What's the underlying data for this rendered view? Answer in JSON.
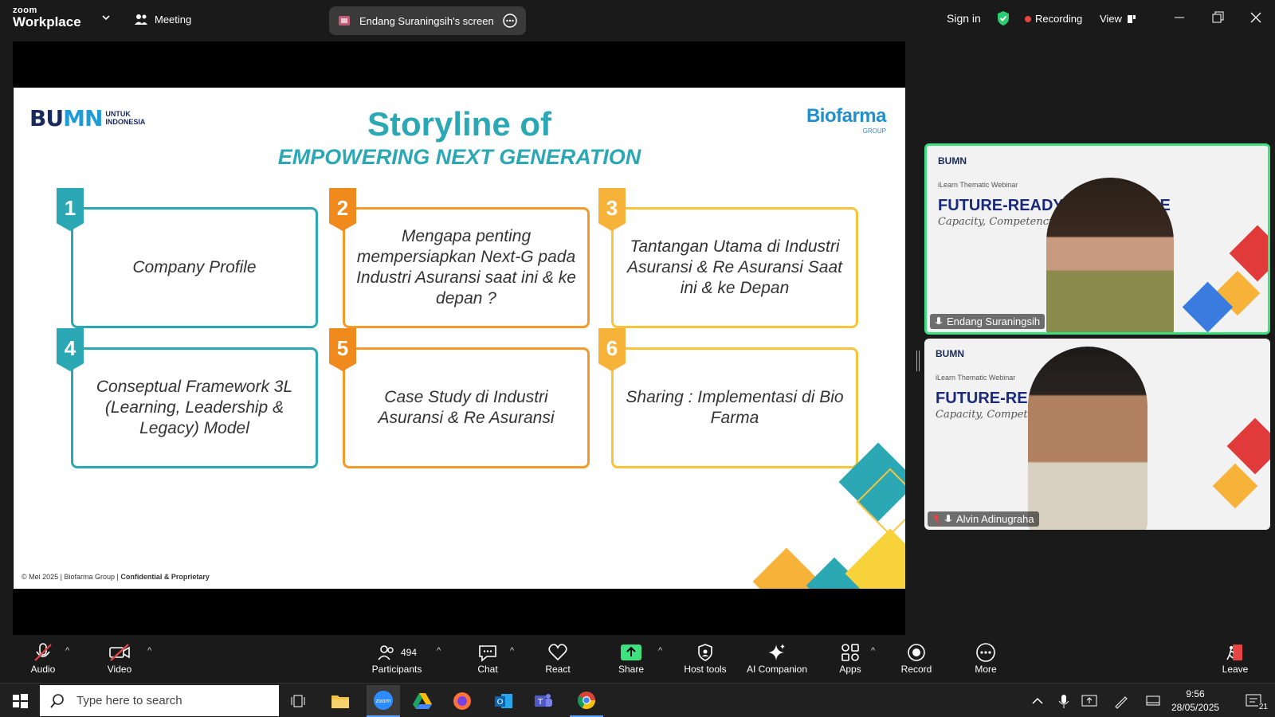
{
  "app": {
    "brand_small": "zoom",
    "brand_big": "Workplace",
    "meeting_label": "Meeting",
    "share_label": "Endang Suraningsih's screen",
    "sign_in": "Sign in",
    "recording": "Recording",
    "view": "View"
  },
  "slide": {
    "bumn_sub": "UNTUK\nINDONESIA",
    "biofarma": "Biofarma",
    "biofarma_group": "GROUP",
    "title": "Storyline of",
    "subtitle": "EMPOWERING NEXT GENERATION",
    "cards": [
      {
        "num": "1",
        "text": "Company Profile"
      },
      {
        "num": "2",
        "text": "Mengapa penting mempersiapkan Next-G pada Industri Asuransi saat ini & ke depan ?"
      },
      {
        "num": "3",
        "text": "Tantangan Utama di Industri Asuransi & Re Asuransi Saat ini & ke Depan"
      },
      {
        "num": "4",
        "text": "Conseptual Framework 3L (Learning, Leadership & Legacy) Model"
      },
      {
        "num": "5",
        "text": "Case Study di Industri Asuransi & Re Asuransi"
      },
      {
        "num": "6",
        "text": "Sharing : Implementasi di Bio Farma"
      }
    ],
    "footer_left": "© Mei 2025 | Biofarma Group | ",
    "footer_bold": "Confidential & Proprietary"
  },
  "participants": [
    {
      "name": "Endang Suraningsih",
      "title": "FUTURE-READY TA          SURANCE",
      "ilearn": "iLearn Thematic Webinar",
      "script": "Capacity, Competency, and Culture",
      "bumn": "BUMN",
      "active": true
    },
    {
      "name": "Alvin Adinugraha",
      "title": "FUTURE-REA                INSURANCE",
      "ilearn": "iLearn Thematic Webinar",
      "script": "Capacity, Competency, and",
      "bumn": "BUMN",
      "active": false
    }
  ],
  "toolbar": {
    "audio": "Audio",
    "video": "Video",
    "participants": "Participants",
    "participant_count": "494",
    "chat": "Chat",
    "react": "React",
    "share": "Share",
    "host_tools": "Host tools",
    "ai_companion": "AI Companion",
    "apps": "Apps",
    "record": "Record",
    "more": "More",
    "leave": "Leave"
  },
  "taskbar": {
    "search_placeholder": "Type here to search",
    "time": "9:56",
    "date": "28/05/2025",
    "notif_count": "21"
  },
  "colors": {
    "teal": "#2ba8b4",
    "orange": "#f08a1c",
    "yellow": "#f7b23a",
    "share_green": "#3ee07f",
    "rec_red": "#e64545"
  }
}
